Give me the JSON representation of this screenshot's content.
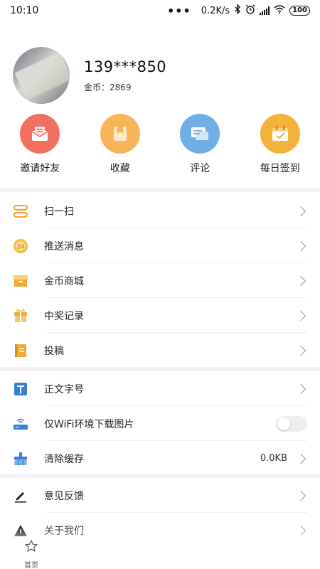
{
  "status_bar": {
    "time": "10:10",
    "dots": "•••",
    "net_speed": "0.2K/s",
    "battery": "100"
  },
  "profile": {
    "phone": "139***850",
    "coins_label": "金币：2869"
  },
  "quick_actions": [
    {
      "label": "邀请好友",
      "color": "#f07162"
    },
    {
      "label": "收藏",
      "color": "#f7b55a"
    },
    {
      "label": "评论",
      "color": "#72aee6"
    },
    {
      "label": "每日签到",
      "color": "#f2b23b"
    }
  ],
  "menu": {
    "group1": [
      {
        "label": "扫一扫"
      },
      {
        "label": "推送消息"
      },
      {
        "label": "金币商城"
      },
      {
        "label": "中奖记录"
      },
      {
        "label": "投稿"
      }
    ],
    "group2": [
      {
        "label": "正文字号"
      },
      {
        "label": "仅WiFi环境下载图片",
        "toggle_on": false
      },
      {
        "label": "清除缓存",
        "value": "0.0KB"
      }
    ],
    "group3": [
      {
        "label": "意见反馈"
      },
      {
        "label": "关于我们"
      }
    ]
  },
  "bottom_nav": {
    "home_label": "首页"
  },
  "colors": {
    "accent_orange": "#f2a93b",
    "blue_icon": "#3a7fd6",
    "divider": "#f2f2f2"
  }
}
